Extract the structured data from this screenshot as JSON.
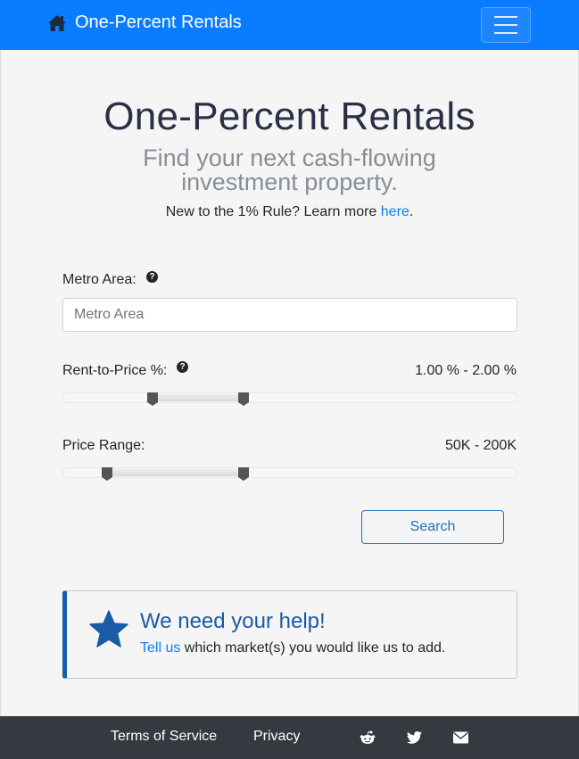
{
  "navbar": {
    "brand": "One-Percent Rentals",
    "brand_icon": "home-icon",
    "menu_icon": "hamburger-menu-icon"
  },
  "hero": {
    "title": "One-Percent Rentals",
    "subtitle": "Find your next cash-flowing investment property.",
    "note_prefix": "New to the 1% Rule? Learn more ",
    "note_link": "here",
    "note_suffix": "."
  },
  "form": {
    "metro": {
      "label": "Metro Area:",
      "help_icon": "question-circle-icon",
      "placeholder": "Metro Area",
      "value": ""
    },
    "rent_to_price": {
      "label": "Rent-to-Price %:",
      "help_icon": "question-circle-icon",
      "value_text": "1.00 % - 2.00 %",
      "low": 1.0,
      "high": 2.0
    },
    "price_range": {
      "label": "Price Range:",
      "value_text": "50K - 200K",
      "low": 50,
      "high": 200
    },
    "search_label": "Search"
  },
  "help": {
    "icon": "star-icon",
    "title": "We need your help!",
    "link": "Tell us",
    "text": " which market(s) you would like us to add."
  },
  "footer": {
    "terms": "Terms of Service",
    "privacy": "Privacy",
    "icons": [
      "reddit-icon",
      "twitter-icon",
      "envelope-icon"
    ]
  },
  "colors": {
    "navbar": "#0a7cff",
    "accent": "#1a5aa6",
    "footer": "#343a40",
    "background": "#f5f5f5"
  }
}
